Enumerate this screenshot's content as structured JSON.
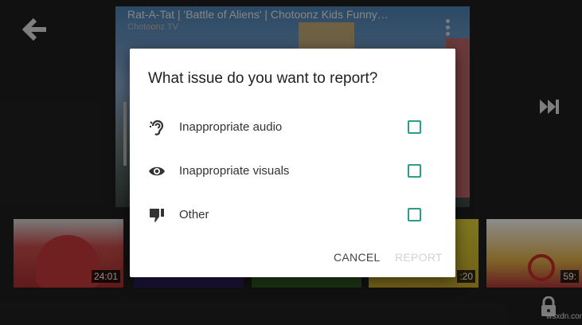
{
  "player": {
    "video_title": "Rat-A-Tat | 'Battle of Aliens' | Chotoonz Kids Funny…",
    "channel": "Chotoonz TV"
  },
  "icons": {
    "back": "arrow-left-icon",
    "more": "more-vert-icon",
    "next": "skip-next-icon",
    "lock": "lock-icon"
  },
  "thumbnails": [
    {
      "duration": "24:01"
    },
    {
      "duration": ""
    },
    {
      "duration": ""
    },
    {
      "duration": ":20"
    },
    {
      "duration": "59:"
    }
  ],
  "dialog": {
    "title": "What issue do you want to report?",
    "options": [
      {
        "label": "Inappropriate audio",
        "icon": "ear-icon",
        "checked": false
      },
      {
        "label": "Inappropriate visuals",
        "icon": "eye-icon",
        "checked": false
      },
      {
        "label": "Other",
        "icon": "thumb-down-icon",
        "checked": false
      }
    ],
    "cancel_label": "CANCEL",
    "report_label": "REPORT",
    "checkbox_color": "#2a9d8f"
  },
  "watermark": "wsxdn.com"
}
